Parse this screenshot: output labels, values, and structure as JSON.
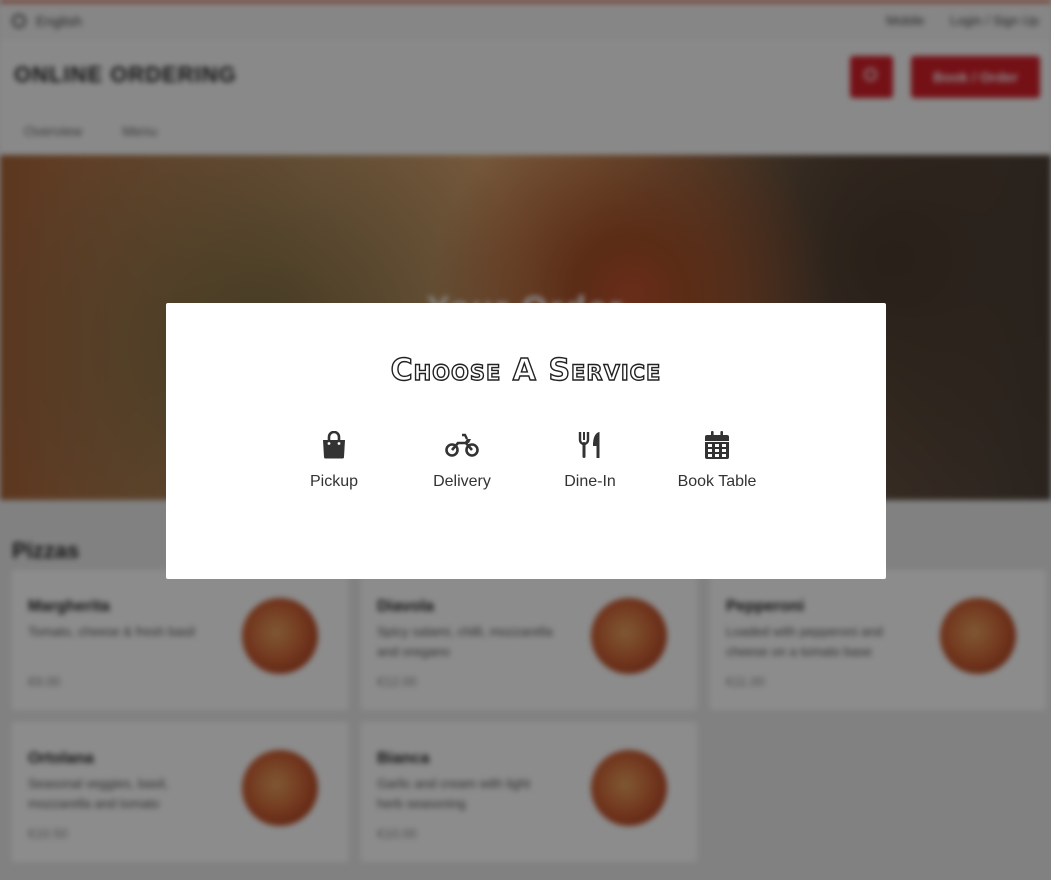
{
  "topbar": {
    "language": "English",
    "links": [
      "Mobile",
      "Login / Sign Up"
    ]
  },
  "header": {
    "brand": "ONLINE ORDERING",
    "order_button": "Book / Order",
    "nav": [
      "Overview",
      "Menu"
    ]
  },
  "hero": {
    "title": "Your Order"
  },
  "menu": {
    "section_title": "Pizzas",
    "items": [
      {
        "name": "Margherita",
        "desc": "Tomato, cheese & fresh basil",
        "price": "€9.00"
      },
      {
        "name": "Diavola",
        "desc": "Spicy salami, chilli, mozzarella and oregano",
        "price": "€12.00"
      },
      {
        "name": "Pepperoni",
        "desc": "Loaded with pepperoni and cheese on a tomato base",
        "price": "€11.00"
      },
      {
        "name": "Ortolana",
        "desc": "Seasonal veggies, basil, mozzarella and tomato",
        "price": "€10.50"
      },
      {
        "name": "Bianca",
        "desc": "Garlic and cream with light herb seasoning",
        "price": "€10.00"
      }
    ]
  },
  "modal": {
    "heading": "Choose A Service",
    "options": [
      {
        "label": "Pickup",
        "icon": "shopping-bag-icon"
      },
      {
        "label": "Delivery",
        "icon": "motorcycle-icon"
      },
      {
        "label": "Dine-In",
        "icon": "utensils-icon"
      },
      {
        "label": "Book Table",
        "icon": "calendar-icon"
      }
    ]
  }
}
